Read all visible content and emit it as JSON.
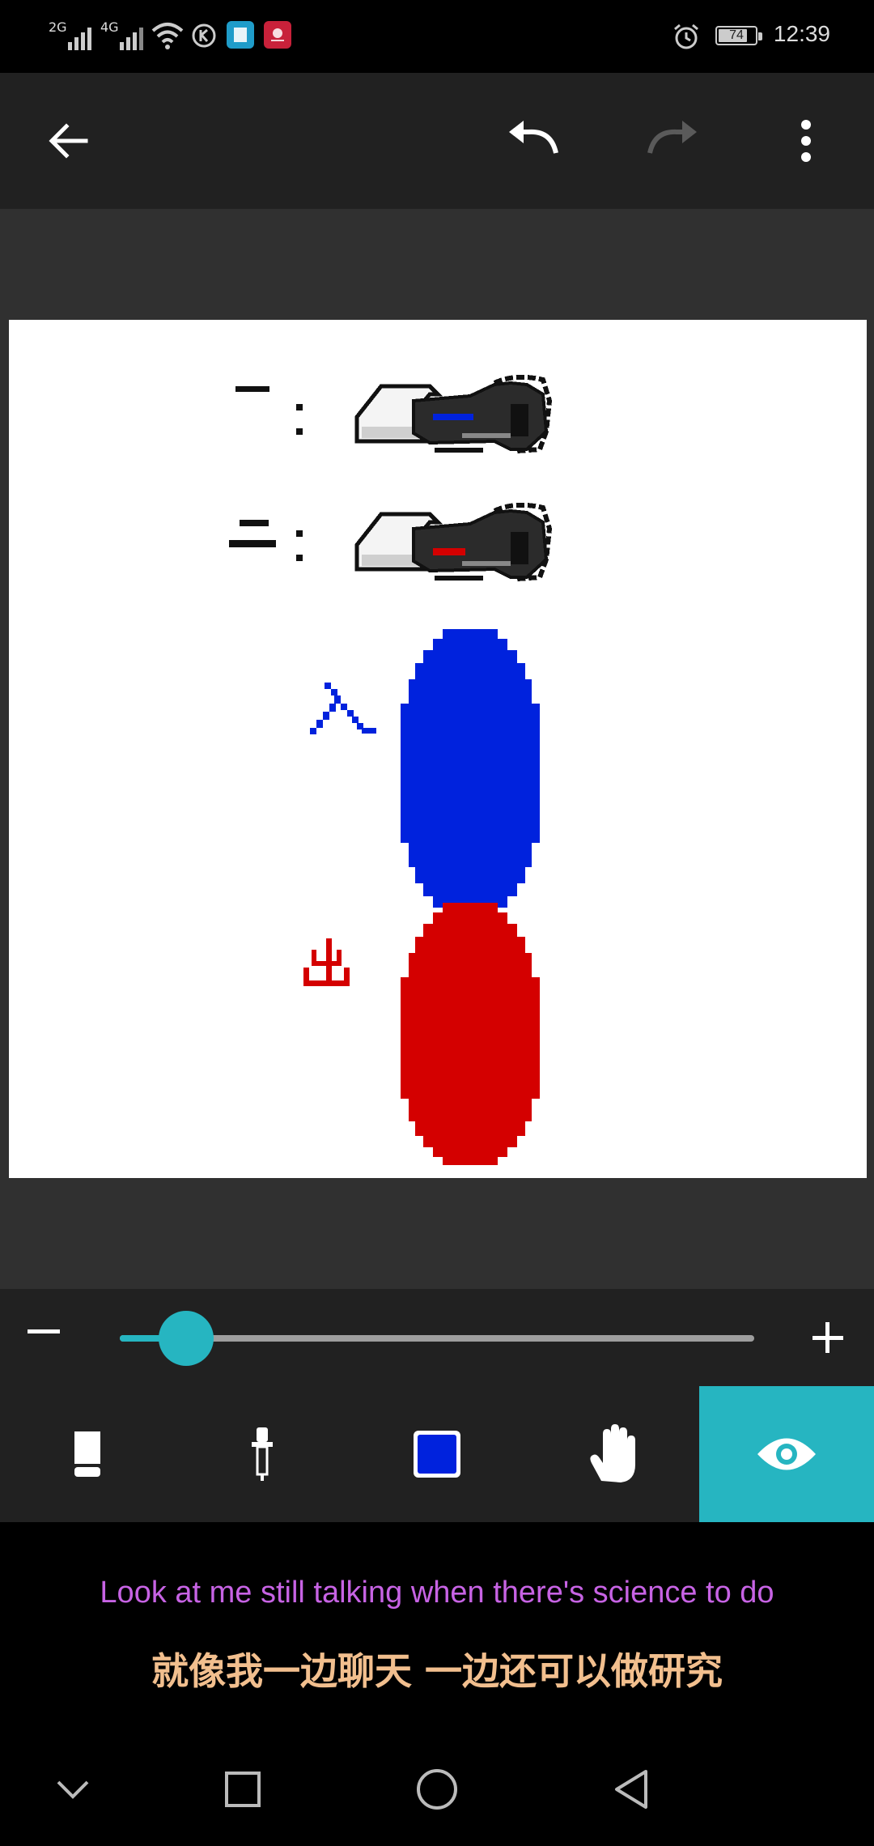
{
  "status_bar": {
    "signal_1_label": "2G",
    "signal_2_label": "4G",
    "battery_level": "74",
    "time": "12:39",
    "icons": [
      "signal-2g-icon",
      "signal-4g-icon",
      "wifi-icon",
      "k-app-icon",
      "book-app-icon",
      "huawei-app-icon",
      "alarm-icon",
      "battery-icon"
    ]
  },
  "toolbar": {
    "icons": [
      "back-arrow-icon",
      "undo-icon",
      "redo-icon",
      "more-vert-icon"
    ],
    "redo_enabled": false
  },
  "canvas": {
    "background": "#ffffff",
    "label_row1": "一",
    "label_row2": "二",
    "label_blue": "入",
    "label_red": "出",
    "colon": ":",
    "colors": {
      "blue": "#0022dd",
      "red": "#d40000",
      "ink": "#111111"
    }
  },
  "brush_size": {
    "minus_label": "−",
    "plus_label": "+",
    "value_fraction": 0.07
  },
  "tools": {
    "items": [
      "eraser-icon",
      "eyedropper-icon",
      "color-swatch-icon",
      "hand-pan-icon",
      "eye-preview-icon"
    ],
    "active": "eye-preview-icon",
    "current_color": "#0022dd",
    "accent": "#26b5c1"
  },
  "subtitles": {
    "english": "Look at me still talking when there's science to do",
    "chinese": "就像我一边聊天 一边还可以做研究"
  },
  "nav_bar": {
    "icons": [
      "chevron-down-icon",
      "recents-square-icon",
      "home-circle-icon",
      "back-triangle-icon"
    ]
  }
}
